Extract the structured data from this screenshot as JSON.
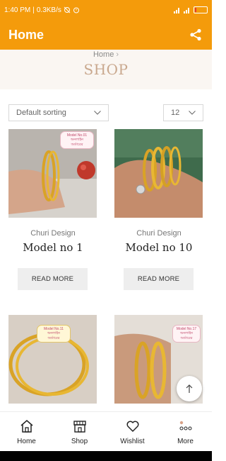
{
  "status_bar": {
    "time": "1:40 PM",
    "speed": "0.3KB/s",
    "battery_level": 0.12,
    "battery_color": "#e53935"
  },
  "app_bar": {
    "title": "Home",
    "background": "#f49b0b"
  },
  "hero": {
    "breadcrumb_home": "Home",
    "page_title": "SHOP"
  },
  "filters": {
    "sort_label": "Default sorting",
    "per_page": "12"
  },
  "products": [
    {
      "category": "Churi Design",
      "name": "Model no 1",
      "button": "READ MORE",
      "tag_lines": [
        "Model No.01",
        "অনলাইন",
        "অর্ডারের"
      ]
    },
    {
      "category": "Churi Design",
      "name": "Model no 10",
      "button": "READ MORE",
      "tag_lines": []
    },
    {
      "category": "",
      "name": "",
      "button": "",
      "tag_lines": [
        "Model No.11",
        "অনলাইন",
        "অর্ডারের"
      ]
    },
    {
      "category": "",
      "name": "",
      "button": "",
      "tag_lines": [
        "Model No.17",
        "অনলাইন",
        "অর্ডারের"
      ]
    }
  ],
  "bottom_nav": [
    {
      "label": "Home",
      "icon": "home-icon"
    },
    {
      "label": "Shop",
      "icon": "store-icon"
    },
    {
      "label": "Wishlist",
      "icon": "heart-icon"
    },
    {
      "label": "More",
      "icon": "more-icon"
    }
  ]
}
